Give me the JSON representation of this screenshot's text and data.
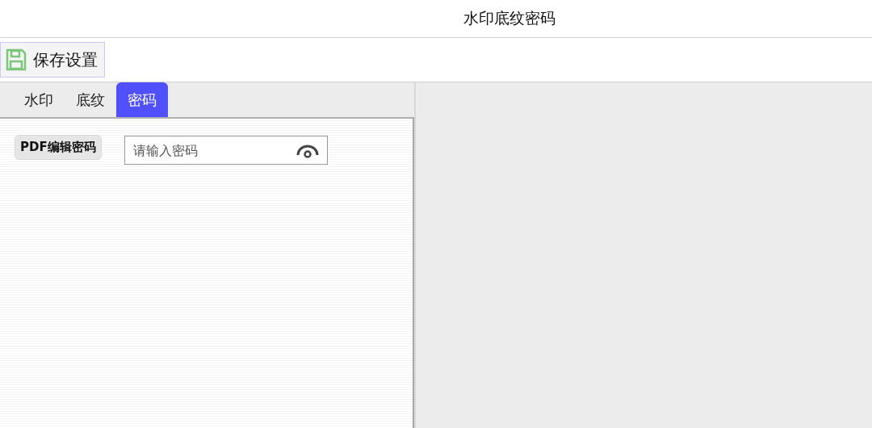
{
  "window": {
    "title": "水印底纹密码"
  },
  "toolbar": {
    "save_button": "保存设置"
  },
  "tabs": [
    {
      "label": "水印",
      "selected": false
    },
    {
      "label": "底纹",
      "selected": false
    },
    {
      "label": "密码",
      "selected": true
    }
  ],
  "password_panel": {
    "label": "PDF编辑密码",
    "field": {
      "placeholder": "请输入密码"
    }
  }
}
